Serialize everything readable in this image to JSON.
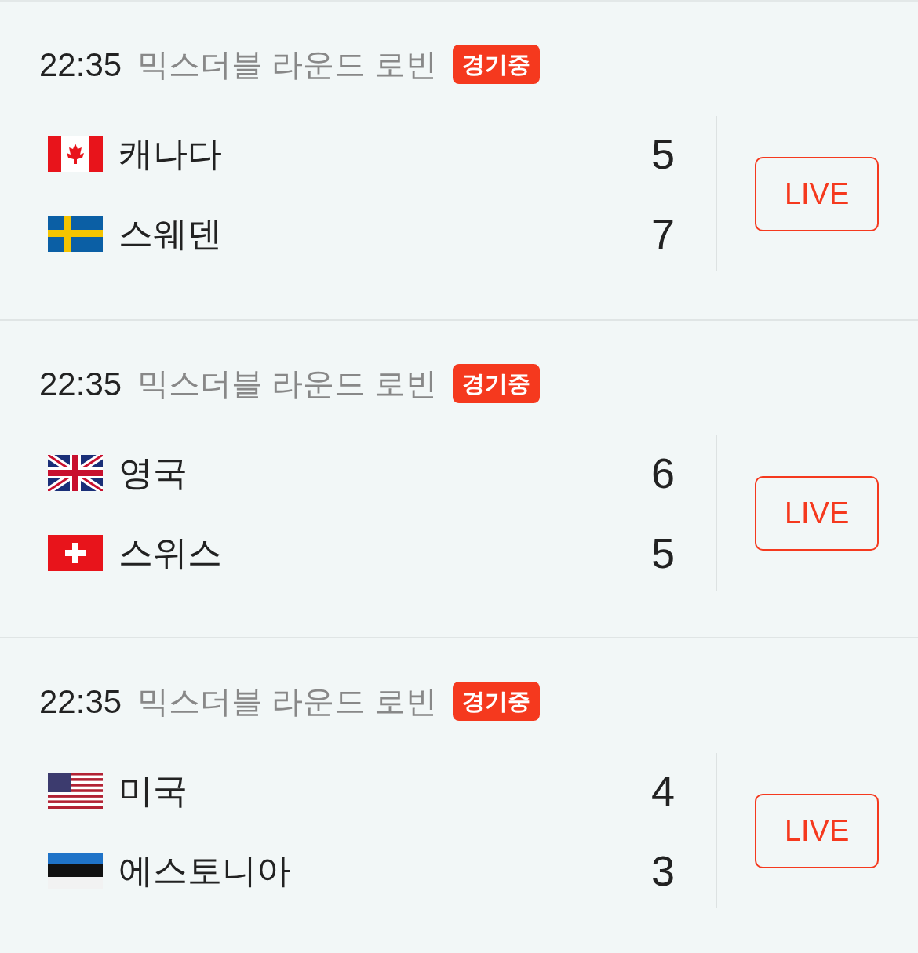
{
  "matches": [
    {
      "time": "22:35",
      "title": "믹스더블 라운드 로빈",
      "status": "경기중",
      "live": "LIVE",
      "teams": [
        {
          "name": "캐나다",
          "kind": "canada",
          "score": "5"
        },
        {
          "name": "스웨덴",
          "kind": "sweden",
          "score": "7"
        }
      ]
    },
    {
      "time": "22:35",
      "title": "믹스더블 라운드 로빈",
      "status": "경기중",
      "live": "LIVE",
      "teams": [
        {
          "name": "영국",
          "kind": "uk",
          "score": "6"
        },
        {
          "name": "스위스",
          "kind": "switzerland",
          "score": "5"
        }
      ]
    },
    {
      "time": "22:35",
      "title": "믹스더블 라운드 로빈",
      "status": "경기중",
      "live": "LIVE",
      "teams": [
        {
          "name": "미국",
          "kind": "usa",
          "score": "4"
        },
        {
          "name": "에스토니아",
          "kind": "estonia",
          "score": "3"
        }
      ]
    }
  ]
}
